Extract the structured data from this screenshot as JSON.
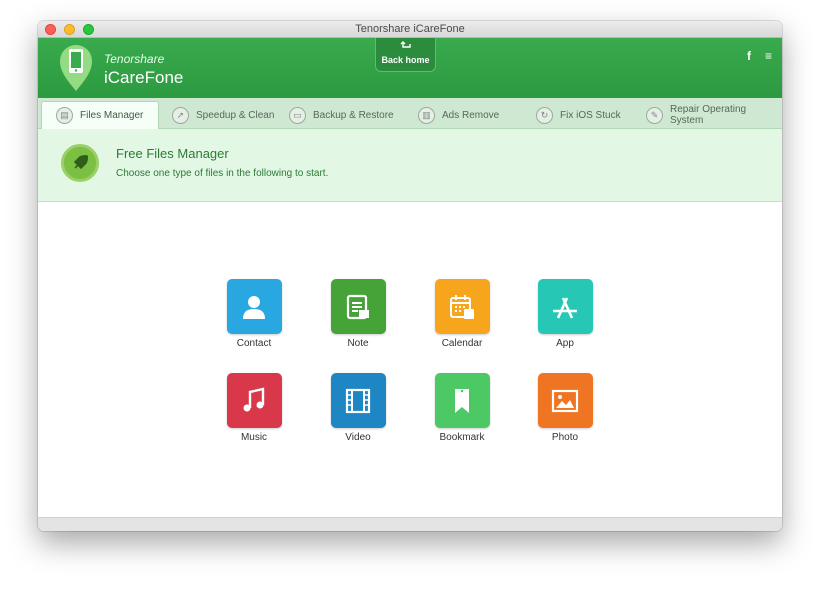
{
  "window": {
    "title": "Tenorshare iCareFone"
  },
  "header": {
    "brand_top": "Tenorshare",
    "brand_main": "iCareFone",
    "back_home": "Back home",
    "facebook_icon": "f",
    "menu_icon": "≡"
  },
  "tabs": [
    {
      "label": "Files Manager",
      "icon": "files-icon",
      "active": true
    },
    {
      "label": "Speedup & Clean",
      "icon": "rocket-icon",
      "active": false
    },
    {
      "label": "Backup & Restore",
      "icon": "backup-icon",
      "active": false
    },
    {
      "label": "Ads Remove",
      "icon": "trash-icon",
      "active": false
    },
    {
      "label": "Fix iOS Stuck",
      "icon": "refresh-icon",
      "active": false
    },
    {
      "label": "Repair Operating System",
      "icon": "wrench-icon",
      "active": false
    }
  ],
  "banner": {
    "title": "Free Files Manager",
    "subtitle": "Choose one type of files in the following to start."
  },
  "files": [
    {
      "label": "Contact",
      "color": "#29a7e1",
      "icon": "contact-icon"
    },
    {
      "label": "Note",
      "color": "#45a337",
      "icon": "note-icon"
    },
    {
      "label": "Calendar",
      "color": "#f7a51c",
      "icon": "calendar-icon"
    },
    {
      "label": "App",
      "color": "#27c7b6",
      "icon": "app-store-icon"
    },
    {
      "label": "Music",
      "color": "#d9384a",
      "icon": "music-icon"
    },
    {
      "label": "Video",
      "color": "#1e86c2",
      "icon": "video-icon"
    },
    {
      "label": "Bookmark",
      "color": "#4cc864",
      "icon": "bookmark-icon"
    },
    {
      "label": "Photo",
      "color": "#ef7522",
      "icon": "photo-icon"
    }
  ]
}
